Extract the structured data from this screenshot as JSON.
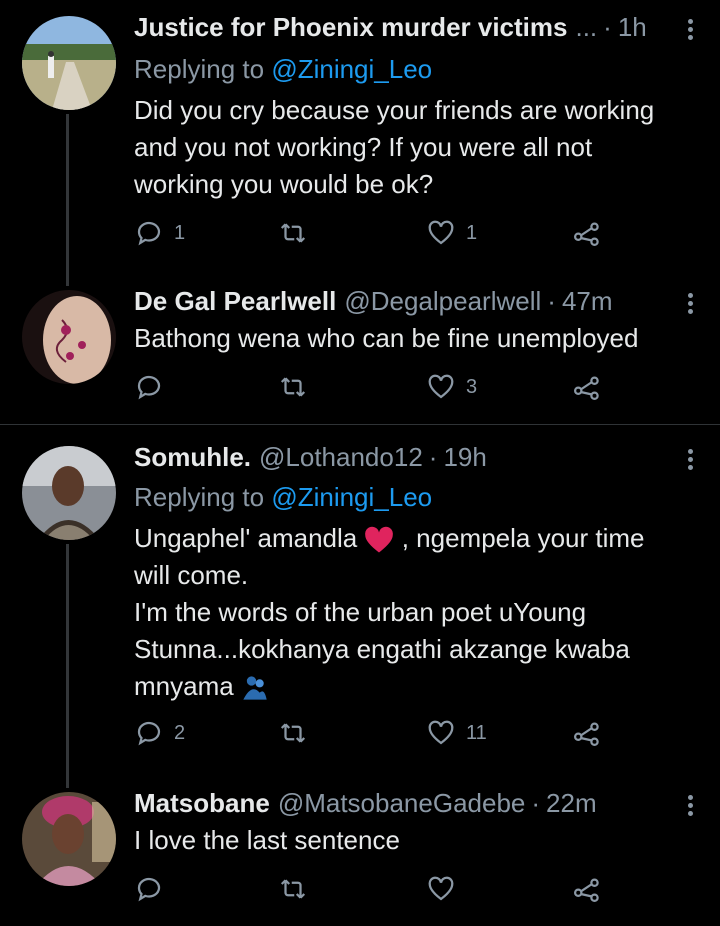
{
  "tweets": [
    {
      "name": "Justice for Phoenix murder victims",
      "ellipsis": "...",
      "handle": "",
      "dot": "·",
      "time": "1h",
      "replying_prefix": "Replying to",
      "replying_handle": "@Ziningi_Leo",
      "lines": [
        "Did you cry because your friends are working",
        "and you not working?  If you were all not",
        "working you would be ok?"
      ],
      "replies": "1",
      "retweets": "",
      "likes": "1"
    },
    {
      "name": "De Gal Pearlwell",
      "handle": "@Degalpearlwell",
      "dot": "·",
      "time": "47m",
      "lines": [
        "Bathong wena who can be fine unemployed"
      ],
      "replies": "",
      "retweets": "",
      "likes": "3"
    },
    {
      "name": "Somuhle.",
      "handle": "@Lothando12",
      "dot": "·",
      "time": "19h",
      "replying_prefix": "Replying to",
      "replying_handle": "@Ziningi_Leo",
      "line1_a": "Ungaphel' amandla",
      "line1_b": ", ngempela your time",
      "lines": [
        "will come.",
        "I'm the words of the urban poet uYoung",
        "Stunna...kokhanya engathi akzange kwaba",
        "mnyama"
      ],
      "replies": "2",
      "retweets": "",
      "likes": "11"
    },
    {
      "name": "Matsobane",
      "handle": "@MatsobaneGadebe",
      "dot": "·",
      "time": "22m",
      "lines": [
        "I love the last sentence"
      ],
      "replies": "",
      "retweets": "",
      "likes": ""
    }
  ],
  "icons": {
    "reply": "reply-icon",
    "retweet": "retweet-icon",
    "like": "heart-icon",
    "share": "share-icon",
    "more": "more-icon"
  },
  "colors": {
    "background": "#000000",
    "text": "#e7e9ea",
    "secondary": "#8b98a5",
    "link": "#1d9bf0",
    "heart_emoji": "#e0245e"
  }
}
